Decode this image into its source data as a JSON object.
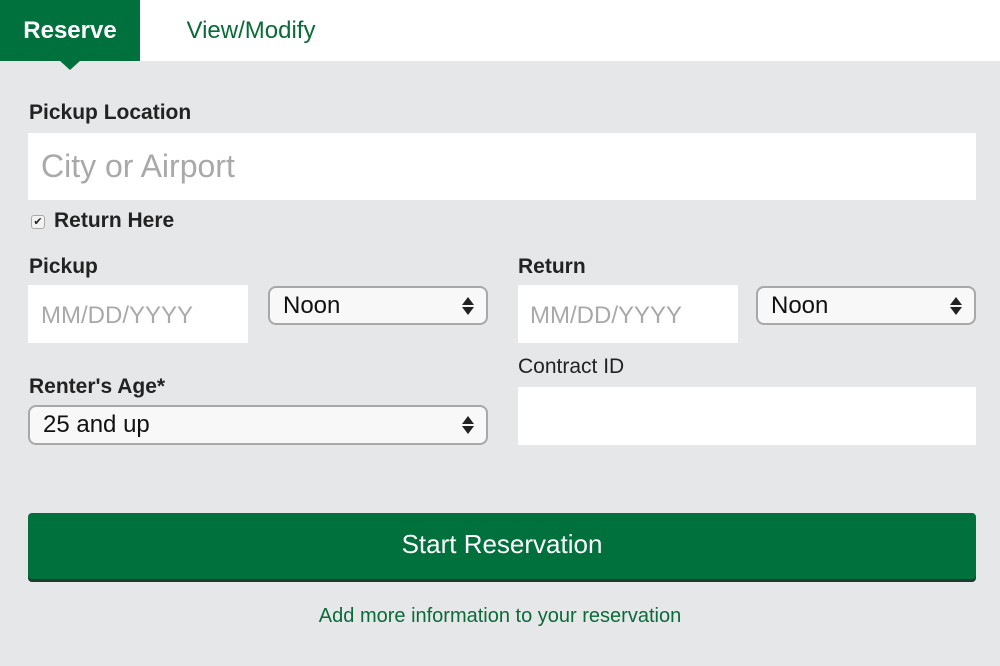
{
  "tabs": [
    {
      "label": "Reserve",
      "active": true
    },
    {
      "label": "View/Modify",
      "active": false
    }
  ],
  "colors": {
    "brand_green": "#00703c",
    "link_green": "#0a6b38",
    "background": "#e6e7e9"
  },
  "form": {
    "pickup_location": {
      "label": "Pickup Location",
      "placeholder": "City or Airport",
      "value": ""
    },
    "return_here": {
      "label": "Return Here",
      "checked": true,
      "check_glyph": "✔"
    },
    "pickup": {
      "label": "Pickup",
      "date_placeholder": "MM/DD/YYYY",
      "date_value": "",
      "time_selected": "Noon"
    },
    "return": {
      "label": "Return",
      "date_placeholder": "MM/DD/YYYY",
      "date_value": "",
      "time_selected": "Noon"
    },
    "renter_age": {
      "label": "Renter's Age*",
      "selected": "25 and up"
    },
    "contract_id": {
      "label": "Contract ID",
      "value": ""
    }
  },
  "actions": {
    "start_label": "Start Reservation",
    "more_info_link": "Add more information to your reservation"
  }
}
